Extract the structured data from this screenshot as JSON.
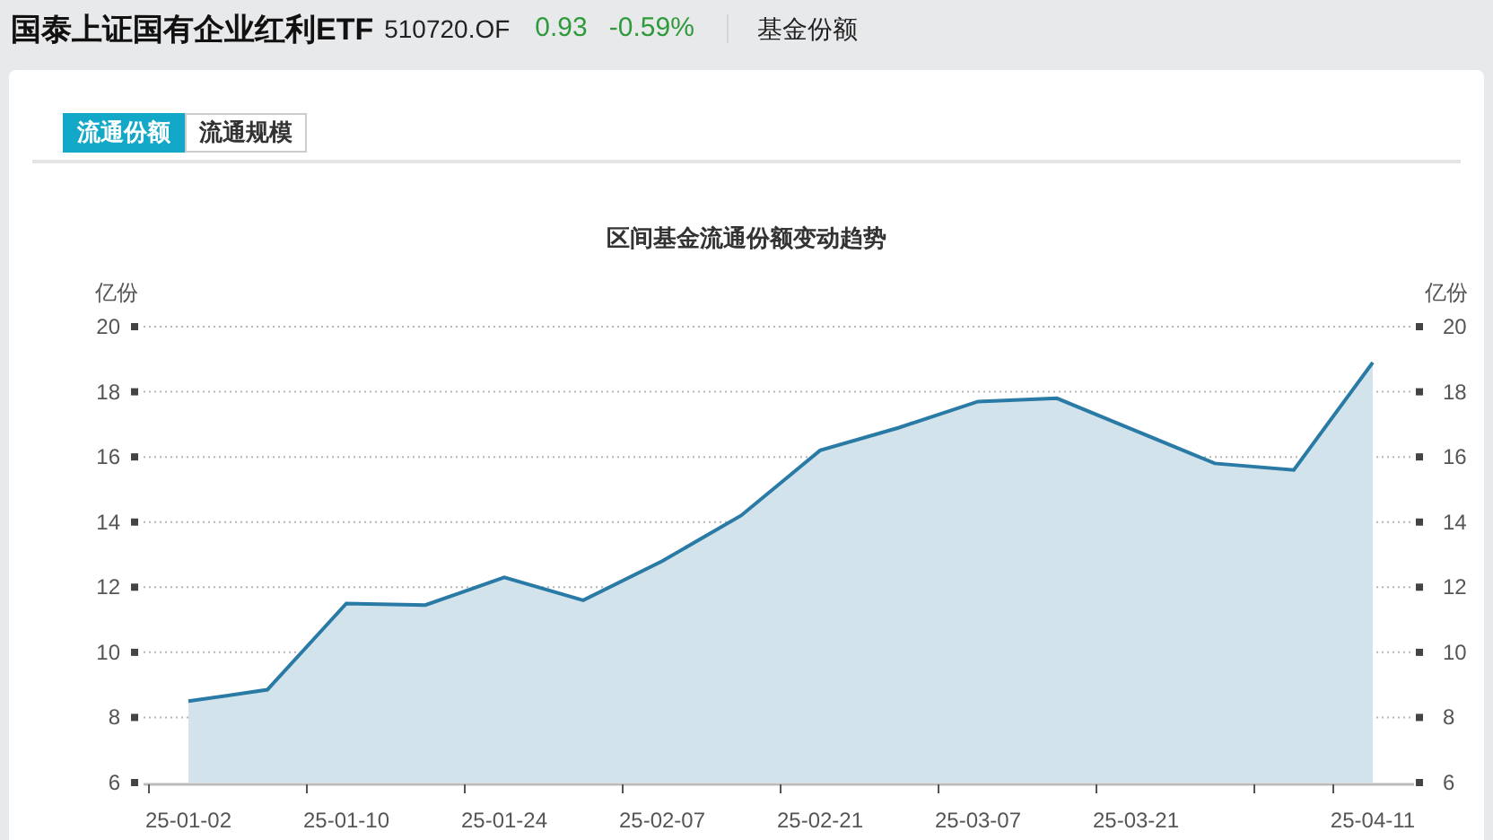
{
  "header": {
    "title": "国泰上证国有企业红利ETF",
    "code": "510720.OF",
    "price": "0.93",
    "change": "-0.59%",
    "section": "基金份额"
  },
  "tabs": [
    {
      "label": "流通份额",
      "selected": true
    },
    {
      "label": "流通规模",
      "selected": false
    }
  ],
  "chart_data": {
    "type": "area",
    "title": "区间基金流通份额变动趋势",
    "ylabel": "亿份",
    "y2label": "亿份",
    "categories": [
      "25-01-02",
      null,
      "25-01-10",
      null,
      "25-01-24",
      null,
      "25-02-07",
      null,
      "25-02-21",
      null,
      "25-03-07",
      null,
      "25-03-21",
      null,
      null,
      "25-04-11"
    ],
    "ylim": [
      6,
      20
    ],
    "yticks": [
      6,
      8,
      10,
      12,
      14,
      16,
      18,
      20
    ],
    "y2ticks": [
      6,
      8,
      10,
      12,
      14,
      16,
      18,
      20
    ],
    "y2lim": [
      6,
      20
    ],
    "grid": true,
    "series": [
      {
        "color": "#2a7aa6",
        "values": [
          8.5,
          8.85,
          11.5,
          11.45,
          12.3,
          11.6,
          12.8,
          14.2,
          16.2,
          16.9,
          17.7,
          17.8,
          16.8,
          15.8,
          15.6,
          18.9
        ]
      }
    ]
  }
}
